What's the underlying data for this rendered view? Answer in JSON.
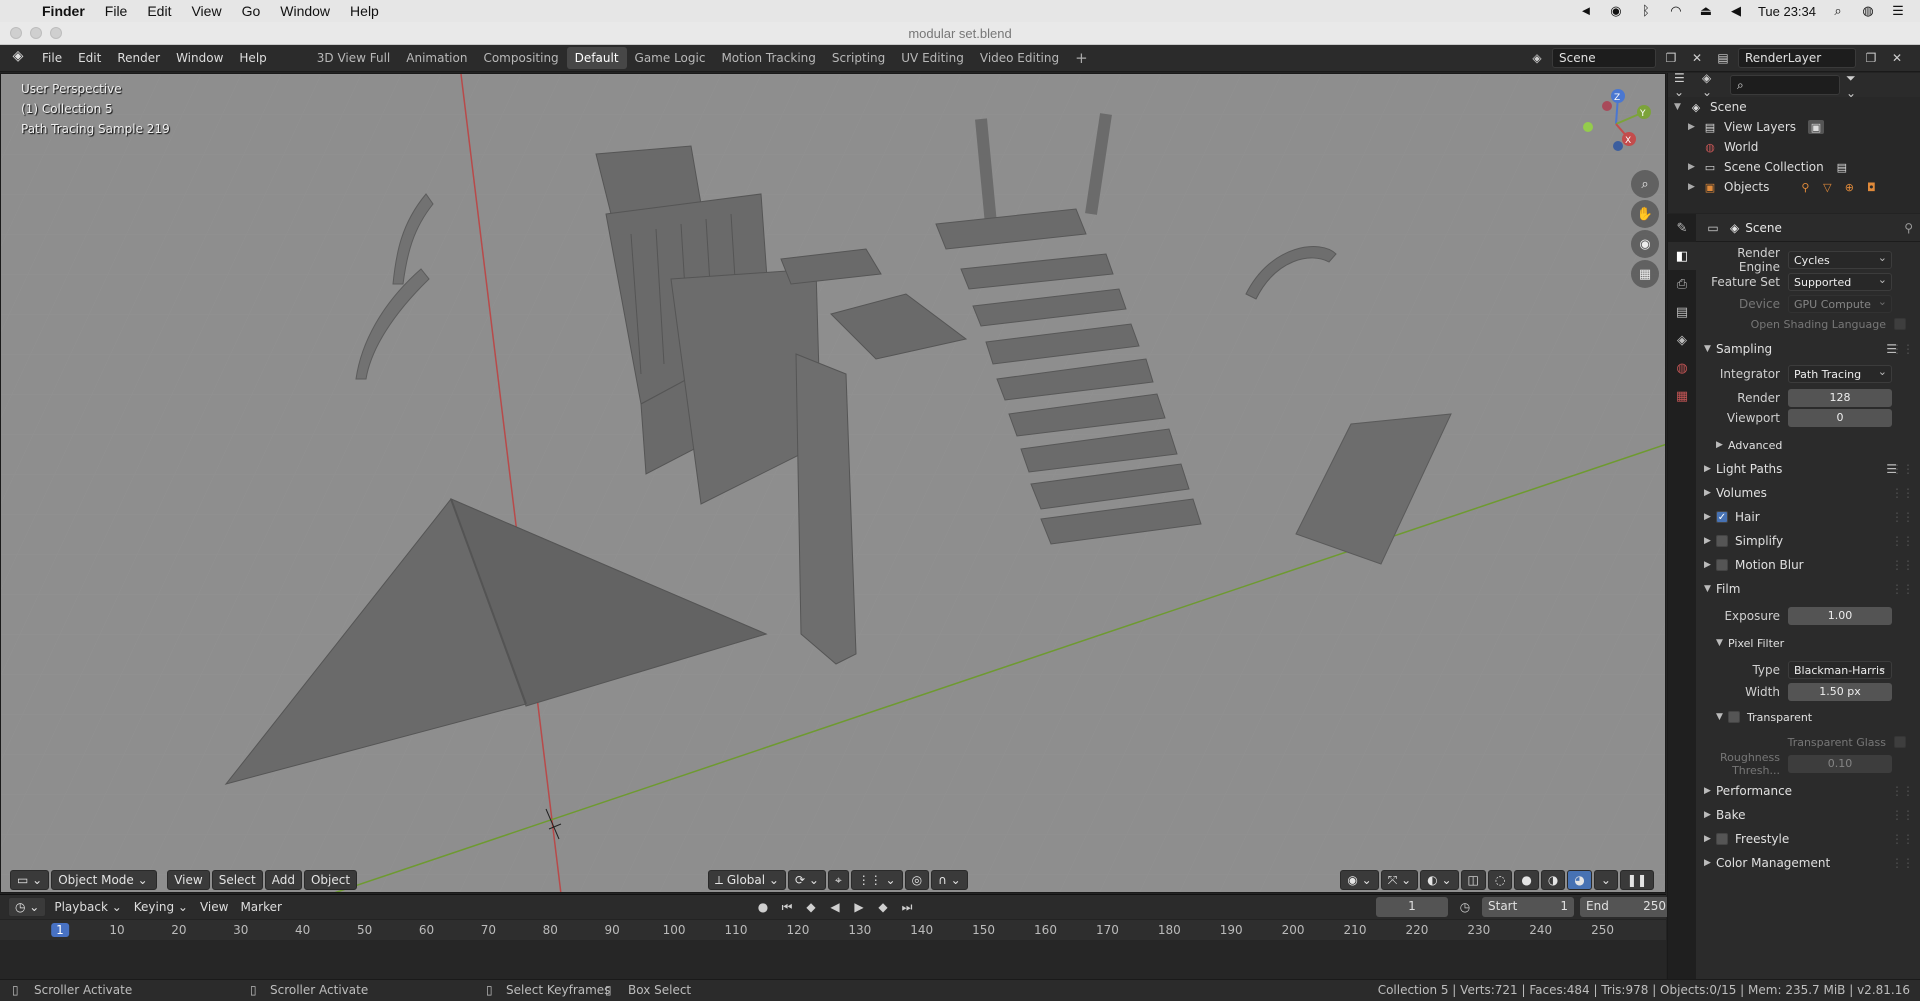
{
  "mac_menubar": {
    "apple": "",
    "app": "Finder",
    "items": [
      "File",
      "Edit",
      "View",
      "Go",
      "Window",
      "Help"
    ],
    "clock": "Tue 23:34"
  },
  "window": {
    "title": "modular set.blend"
  },
  "topbar": {
    "menus": [
      "File",
      "Edit",
      "Render",
      "Window",
      "Help"
    ],
    "workspaces": [
      "3D View Full",
      "Animation",
      "Compositing",
      "Default",
      "Game Logic",
      "Motion Tracking",
      "Scripting",
      "UV Editing",
      "Video Editing"
    ],
    "active_workspace": "Default",
    "add_tab": "+",
    "scene_name": "Scene",
    "view_layer": "RenderLayer"
  },
  "viewport": {
    "perspective": "User Perspective",
    "collection": "(1) Collection 5",
    "render_status": "Path Tracing Sample 219",
    "gizmo_axes": [
      "Z",
      "Y",
      "X"
    ]
  },
  "viewport_header": {
    "mode": "Object Mode",
    "menus": [
      "View",
      "Select",
      "Add",
      "Object"
    ],
    "orientation": "Global"
  },
  "timeline": {
    "menus": [
      "Playback",
      "Keying",
      "View",
      "Marker"
    ],
    "current_frame": "1",
    "start_label": "Start",
    "start": "1",
    "end_label": "End",
    "end": "250",
    "ruler": [
      "1",
      "10",
      "20",
      "30",
      "40",
      "50",
      "60",
      "70",
      "80",
      "90",
      "100",
      "110",
      "120",
      "130",
      "140",
      "150",
      "160",
      "170",
      "180",
      "190",
      "200",
      "210",
      "220",
      "230",
      "240",
      "250"
    ]
  },
  "statusbar": {
    "left1": "Scroller Activate",
    "left2": "Scroller Activate",
    "mid1": "Select Keyframes",
    "mid2": "Box Select",
    "stats": "Collection 5 | Verts:721 | Faces:484 | Tris:978 | Objects:0/15 | Mem: 235.7 MiB | v2.81.16"
  },
  "outliner": {
    "root": "Scene",
    "items": [
      "View Layers",
      "World",
      "Scene Collection",
      "Objects"
    ]
  },
  "properties": {
    "context": "Scene",
    "render_engine_label": "Render Engine",
    "render_engine": "Cycles",
    "feature_set_label": "Feature Set",
    "feature_set": "Supported",
    "device_label": "Device",
    "device": "GPU Compute",
    "osl_label": "Open Shading Language",
    "sampling": "Sampling",
    "integrator_label": "Integrator",
    "integrator": "Path Tracing",
    "render_label": "Render",
    "render_samples": "128",
    "viewport_label": "Viewport",
    "viewport_samples": "0",
    "advanced": "Advanced",
    "light_paths": "Light Paths",
    "volumes": "Volumes",
    "hair": "Hair",
    "simplify": "Simplify",
    "motion_blur": "Motion Blur",
    "film": "Film",
    "exposure_label": "Exposure",
    "exposure": "1.00",
    "pixel_filter": "Pixel Filter",
    "type_label": "Type",
    "filter_type": "Blackman-Harris",
    "width_label": "Width",
    "filter_width": "1.50 px",
    "transparent": "Transparent",
    "transparent_glass": "Transparent Glass",
    "roughness_label": "Roughness Thresh...",
    "roughness": "0.10",
    "performance": "Performance",
    "bake": "Bake",
    "freestyle": "Freestyle",
    "color_management": "Color Management"
  }
}
